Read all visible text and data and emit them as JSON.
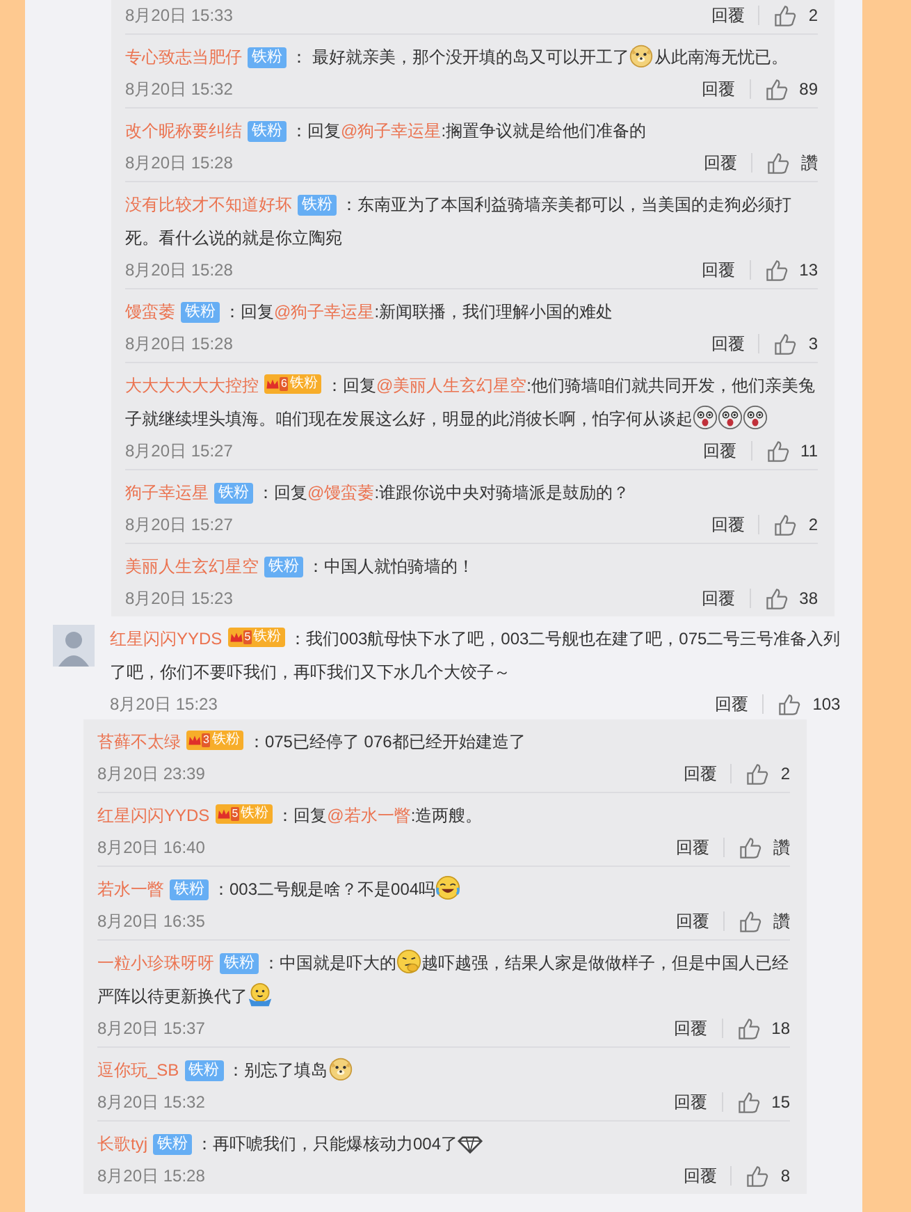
{
  "previous_comment": {
    "partial_row": {
      "time": "8月20日 15:33",
      "reply_label": "回覆",
      "likes": "2"
    },
    "replies": [
      {
        "user": "专心致志当肥仔",
        "badge": {
          "kind": "plain",
          "label": "铁粉"
        },
        "lines": [
          [
            {
              "kind": "text",
              "text": "： 最好就亲美，那个没开填的岛又可以开工了"
            },
            {
              "kind": "doge"
            },
            {
              "kind": "text",
              "text": "从此南海无忧已。"
            }
          ]
        ],
        "time": "8月20日 15:32",
        "reply_label": "回覆",
        "likes": "89"
      },
      {
        "user": "改个昵称要纠结",
        "badge": {
          "kind": "plain",
          "label": "铁粉"
        },
        "lines": [
          [
            {
              "kind": "text",
              "text": "：回复"
            },
            {
              "kind": "mention",
              "text": "@狗子幸运星"
            },
            {
              "kind": "text",
              "text": ":搁置争议就是给他们准备的"
            }
          ]
        ],
        "time": "8月20日 15:28",
        "reply_label": "回覆",
        "likes": "讚"
      },
      {
        "user": "没有比较才不知道好坏",
        "badge": {
          "kind": "plain",
          "label": "铁粉"
        },
        "lines": [
          [
            {
              "kind": "text",
              "text": "：东南亚为了本国利益骑墙亲美都可以，当美国的走狗必须打"
            }
          ],
          [
            {
              "kind": "text",
              "text": "死。看什么说的就是你立陶宛"
            }
          ]
        ],
        "time": "8月20日 15:28",
        "reply_label": "回覆",
        "likes": "13"
      },
      {
        "user": "馒蛮萎",
        "badge": {
          "kind": "plain",
          "label": "铁粉"
        },
        "lines": [
          [
            {
              "kind": "text",
              "text": "：回复"
            },
            {
              "kind": "mention",
              "text": "@狗子幸运星"
            },
            {
              "kind": "text",
              "text": ":新闻联播，我们理解小国的难处"
            }
          ]
        ],
        "time": "8月20日 15:28",
        "reply_label": "回覆",
        "likes": "3"
      },
      {
        "user": "大大大大大大控控",
        "badge": {
          "kind": "crown",
          "rank": "6",
          "label": "铁粉"
        },
        "lines": [
          [
            {
              "kind": "text",
              "text": "：回复"
            },
            {
              "kind": "mention",
              "text": "@美丽人生玄幻星空"
            },
            {
              "kind": "text",
              "text": ":他们骑墙咱们就共同开发，他们亲美兔"
            }
          ],
          [
            {
              "kind": "text",
              "text": "子就继续埋头填海。咱们现在发展这么好，明显的此消彼长啊，怕字何从谈起"
            },
            {
              "kind": "shocked"
            },
            {
              "kind": "shocked"
            },
            {
              "kind": "shocked"
            }
          ]
        ],
        "time": "8月20日 15:27",
        "reply_label": "回覆",
        "likes": "11"
      },
      {
        "user": "狗子幸运星",
        "badge": {
          "kind": "plain",
          "label": "铁粉"
        },
        "lines": [
          [
            {
              "kind": "text",
              "text": "：回复"
            },
            {
              "kind": "mention",
              "text": "@馒蛮萎"
            },
            {
              "kind": "text",
              "text": ":谁跟你说中央对骑墙派是鼓励的？"
            }
          ]
        ],
        "time": "8月20日 15:27",
        "reply_label": "回覆",
        "likes": "2"
      },
      {
        "user": "美丽人生玄幻星空",
        "badge": {
          "kind": "plain",
          "label": "铁粉"
        },
        "lines": [
          [
            {
              "kind": "text",
              "text": "：中国人就怕骑墙的！"
            }
          ]
        ],
        "time": "8月20日 15:23",
        "reply_label": "回覆",
        "likes": "38"
      }
    ]
  },
  "comment": {
    "user": "红星闪闪YYDS",
    "badge": {
      "kind": "crown",
      "rank": "5",
      "label": "铁粉"
    },
    "lines": [
      [
        {
          "kind": "text",
          "text": "：我们003航母快下水了吧，003二号舰也在建了吧，075二号三号准备入列"
        }
      ],
      [
        {
          "kind": "text",
          "text": "了吧，你们不要吓我们，再吓我们又下水几个大饺子～"
        }
      ]
    ],
    "time": "8月20日 15:23",
    "reply_label": "回覆",
    "likes": "103",
    "replies": [
      {
        "user": "苔藓不太绿",
        "badge": {
          "kind": "crown",
          "rank": "3",
          "label": "铁粉"
        },
        "lines": [
          [
            {
              "kind": "text",
              "text": "：075已经停了 076都已经开始建造了"
            }
          ]
        ],
        "time": "8月20日 23:39",
        "reply_label": "回覆",
        "likes": "2"
      },
      {
        "user": "红星闪闪YYDS",
        "badge": {
          "kind": "crown",
          "rank": "5",
          "label": "铁粉"
        },
        "lines": [
          [
            {
              "kind": "text",
              "text": "：回复"
            },
            {
              "kind": "mention",
              "text": "@若水一瞥"
            },
            {
              "kind": "text",
              "text": ":造两艘。"
            }
          ]
        ],
        "time": "8月20日 16:40",
        "reply_label": "回覆",
        "likes": "讚"
      },
      {
        "user": "若水一瞥",
        "badge": {
          "kind": "plain",
          "label": "铁粉"
        },
        "lines": [
          [
            {
              "kind": "text",
              "text": "：003二号舰是啥？不是004吗"
            },
            {
              "kind": "laughing"
            }
          ]
        ],
        "time": "8月20日 16:35",
        "reply_label": "回覆",
        "likes": "讚"
      },
      {
        "user": "一粒小珍珠呀呀",
        "badge": {
          "kind": "plain",
          "label": "铁粉"
        },
        "lines": [
          [
            {
              "kind": "text",
              "text": "：中国就是吓大的"
            },
            {
              "kind": "thinking"
            },
            {
              "kind": "text",
              "text": "越吓越强，结果人家是做做样子，但是中国人已经"
            }
          ],
          [
            {
              "kind": "text",
              "text": "严阵以待更新换代了"
            },
            {
              "kind": "shrugging"
            }
          ]
        ],
        "time": "8月20日 15:37",
        "reply_label": "回覆",
        "likes": "18"
      },
      {
        "user": "逗你玩_SB",
        "badge": {
          "kind": "plain",
          "label": "铁粉"
        },
        "lines": [
          [
            {
              "kind": "text",
              "text": "：别忘了填岛"
            },
            {
              "kind": "doge"
            }
          ]
        ],
        "time": "8月20日 15:32",
        "reply_label": "回覆",
        "likes": "15"
      },
      {
        "user": "长歌tyj",
        "badge": {
          "kind": "plain",
          "label": "铁粉"
        },
        "lines": [
          [
            {
              "kind": "text",
              "text": "：再吓唬我们，只能爆核动力004了"
            },
            {
              "kind": "gem"
            }
          ]
        ],
        "time": "8月20日 15:28",
        "reply_label": "回覆",
        "likes": "8"
      }
    ]
  }
}
